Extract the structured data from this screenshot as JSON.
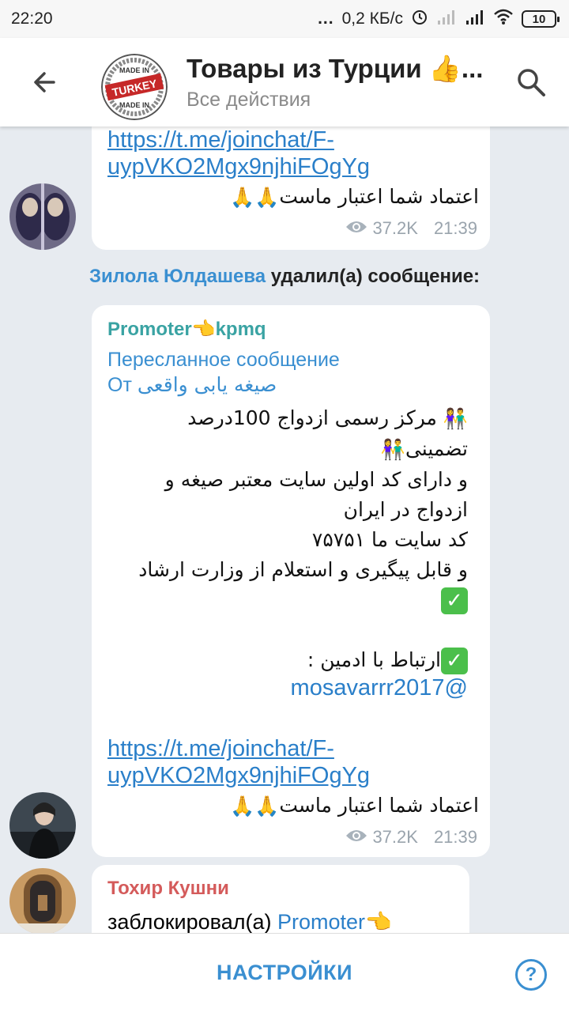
{
  "status_bar": {
    "time": "22:20",
    "dots": "...",
    "speed": "0,2 КБ/с",
    "battery": "10"
  },
  "header": {
    "title": "Товары из Турции 👍...",
    "subtitle": "Все действия",
    "logo_texts": [
      "MADE IN",
      "TURKEY",
      "MADE IN"
    ]
  },
  "messages": {
    "first": {
      "link_line1": "https://t.me/joinchat/F-",
      "link_line2": "uypVKO2Mgx9njhiFOgYg",
      "text": "اعتماد شما اعتبار ماست",
      "emoji": "🙏🙏",
      "views": "37.2K",
      "time": "21:39"
    },
    "service": {
      "user": "Зилола Юлдашева",
      "action": " удалил(а) сообщение:"
    },
    "deleted": {
      "author": "Promoter👈kpmq",
      "forwarded_label": "Пересланное сообщение",
      "from_prefix": "От ",
      "from_name": "صیغه یابی واقعی",
      "line1": "مرکز رسمی ازدواج 100درصد",
      "line2": "تضمینی",
      "line3": " و دارای کد اولین سایت معتبر صیغه و",
      "line4": "ازدواج  در ایران",
      "line5": "کد سایت ما ۷۵۷۵۱",
      "line6": "و قابل پیگیری و استعلام از وزارت ارشاد",
      "check": "✓",
      "line8": "ارتباط با ادمین :",
      "handle": "mosavarrr2017@",
      "link_line1": "https://t.me/joinchat/F-",
      "link_line2": "uypVKO2Mgx9njhiFOgYg",
      "line9": "اعتماد شما اعتبار ماست",
      "emoji": "🙏🙏",
      "couple_emoji": "👫",
      "views": "37.2K",
      "time": "21:39"
    },
    "last": {
      "author": "Тохир Кушни",
      "text": "заблокировал(а) ",
      "target": "Promoter👈"
    }
  },
  "bottom": {
    "settings_label": "НАСТРОЙКИ",
    "help": "?"
  },
  "colors": {
    "accent": "#3a8fd1",
    "link": "#2a7fc9",
    "background": "#e7ebf0"
  }
}
